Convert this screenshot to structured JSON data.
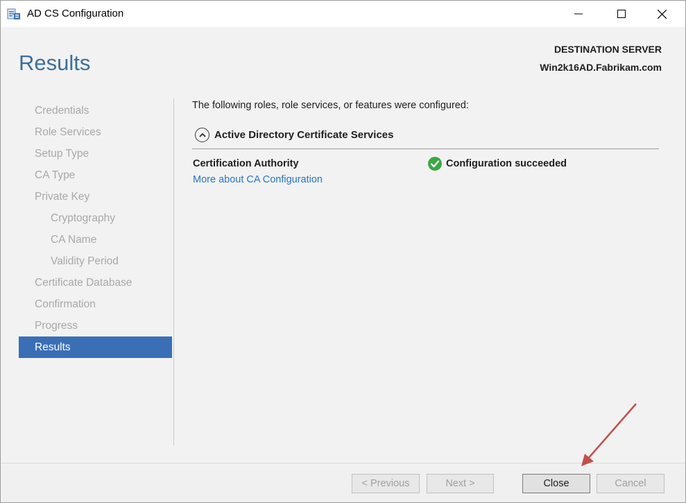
{
  "window": {
    "title": "AD CS Configuration",
    "icon": "server-role-icon",
    "controls": [
      "minimize-icon",
      "maximize-icon",
      "close-icon"
    ]
  },
  "header": {
    "page_title": "Results",
    "destination_label": "DESTINATION SERVER",
    "destination_server": "Win2k16AD.Fabrikam.com"
  },
  "nav": {
    "items": [
      {
        "label": "Credentials",
        "level": 0,
        "active": false
      },
      {
        "label": "Role Services",
        "level": 0,
        "active": false
      },
      {
        "label": "Setup Type",
        "level": 0,
        "active": false
      },
      {
        "label": "CA Type",
        "level": 0,
        "active": false
      },
      {
        "label": "Private Key",
        "level": 0,
        "active": false
      },
      {
        "label": "Cryptography",
        "level": 1,
        "active": false
      },
      {
        "label": "CA Name",
        "level": 1,
        "active": false
      },
      {
        "label": "Validity Period",
        "level": 1,
        "active": false
      },
      {
        "label": "Certificate Database",
        "level": 0,
        "active": false
      },
      {
        "label": "Confirmation",
        "level": 0,
        "active": false
      },
      {
        "label": "Progress",
        "level": 0,
        "active": false
      },
      {
        "label": "Results",
        "level": 0,
        "active": true
      }
    ]
  },
  "content": {
    "intro": "The following roles, role services, or features were configured:",
    "section_title": "Active Directory Certificate Services",
    "role_name": "Certification Authority",
    "role_link": "More about CA Configuration",
    "status_text": "Configuration succeeded",
    "status_icon": "success-check-icon"
  },
  "footer": {
    "previous_label": "< Previous",
    "next_label": "Next >",
    "close_label": "Close",
    "cancel_label": "Cancel"
  },
  "colors": {
    "accent": "#3a6fb6",
    "title": "#3c6e9c",
    "link": "#2b74c2",
    "success": "#3aa844",
    "annotation_arrow": "#c0504d"
  }
}
